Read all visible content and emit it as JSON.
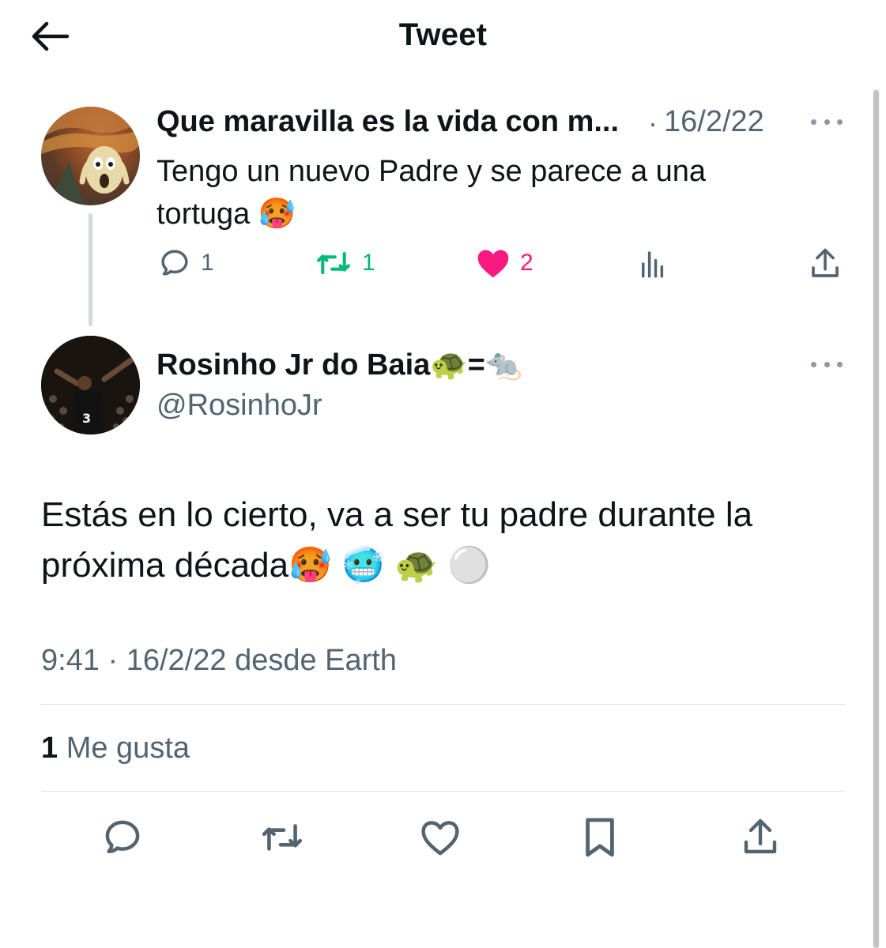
{
  "header": {
    "title": "Tweet"
  },
  "reply_tweet": {
    "author_name": "Que maravilla es la vida con m...",
    "separator": "·",
    "date": "16/2/22",
    "text": "Tengo un nuevo Padre y se parece a una tortuga 🥵",
    "stats": {
      "replies": "1",
      "retweets": "1",
      "likes": "2"
    }
  },
  "main_tweet": {
    "author_name": "Rosinho Jr do Baia🐢=🐀",
    "handle": "@RosinhoJr",
    "text": "Estás en lo cierto, va a ser tu padre durante la próxima década🥵 🥶 🐢 ⚪️",
    "meta": "9:41 · 16/2/22 desde Earth",
    "likes_count": "1",
    "likes_label": "Me gusta"
  },
  "colors": {
    "text_primary": "#0f1419",
    "text_secondary": "#536471",
    "retweet_green": "#00ba7c",
    "like_pink": "#f91880",
    "divider": "#d9dee2"
  },
  "icons": {
    "back": "arrow-left-icon",
    "more": "more-dots-icon",
    "reply": "speech-bubble-icon",
    "retweet": "retweet-arrows-icon",
    "like": "heart-icon",
    "views": "bar-chart-icon",
    "share": "share-upload-icon",
    "bookmark": "bookmark-icon"
  }
}
